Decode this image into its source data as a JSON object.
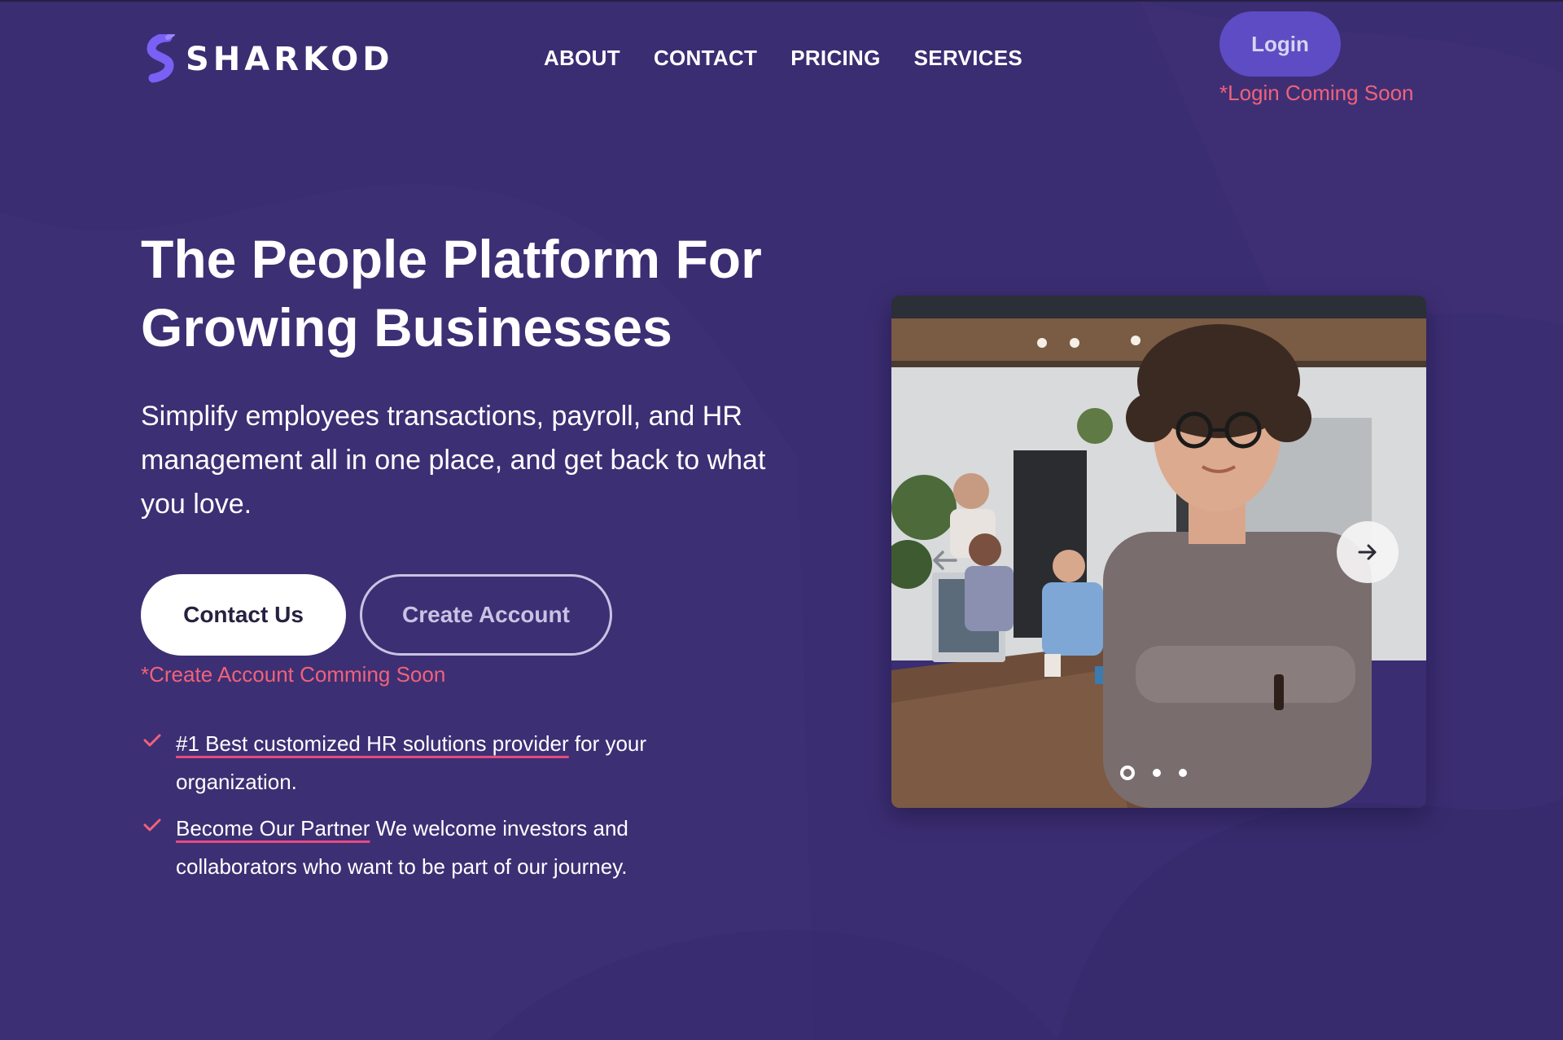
{
  "brand": {
    "name": "SHARKOD",
    "accent": "#6b5cf0"
  },
  "nav": {
    "items": [
      {
        "label": "ABOUT"
      },
      {
        "label": "CONTACT"
      },
      {
        "label": "PRICING"
      },
      {
        "label": "SERVICES"
      }
    ]
  },
  "header": {
    "login_label": "Login",
    "login_note": "*Login Coming Soon"
  },
  "hero": {
    "title_line1": "The People Platform For",
    "title_line2": "Growing Businesses",
    "subtitle": "Simplify employees transactions, payroll, and HR management all in one place, and get back to what you love.",
    "contact_button": "Contact Us",
    "create_button": "Create Account",
    "create_note": "*Create Account Comming Soon"
  },
  "features": [
    {
      "highlight": "#1 Best customized HR solutions provider",
      "rest": " for your organization.",
      "icon": "check-icon"
    },
    {
      "highlight": "Become Our Partner",
      "rest": " We welcome investors and collaborators who want to be part of our journey.",
      "icon": "check-icon"
    }
  ],
  "carousel": {
    "slide_count": 3,
    "active_slide": 1,
    "prev_icon": "arrow-left-icon",
    "next_icon": "arrow-right-icon"
  },
  "colors": {
    "background": "#3b2d72",
    "note_red": "#f0627a",
    "underline_pink": "#e84a7f",
    "login_button": "#5e4cc4"
  }
}
